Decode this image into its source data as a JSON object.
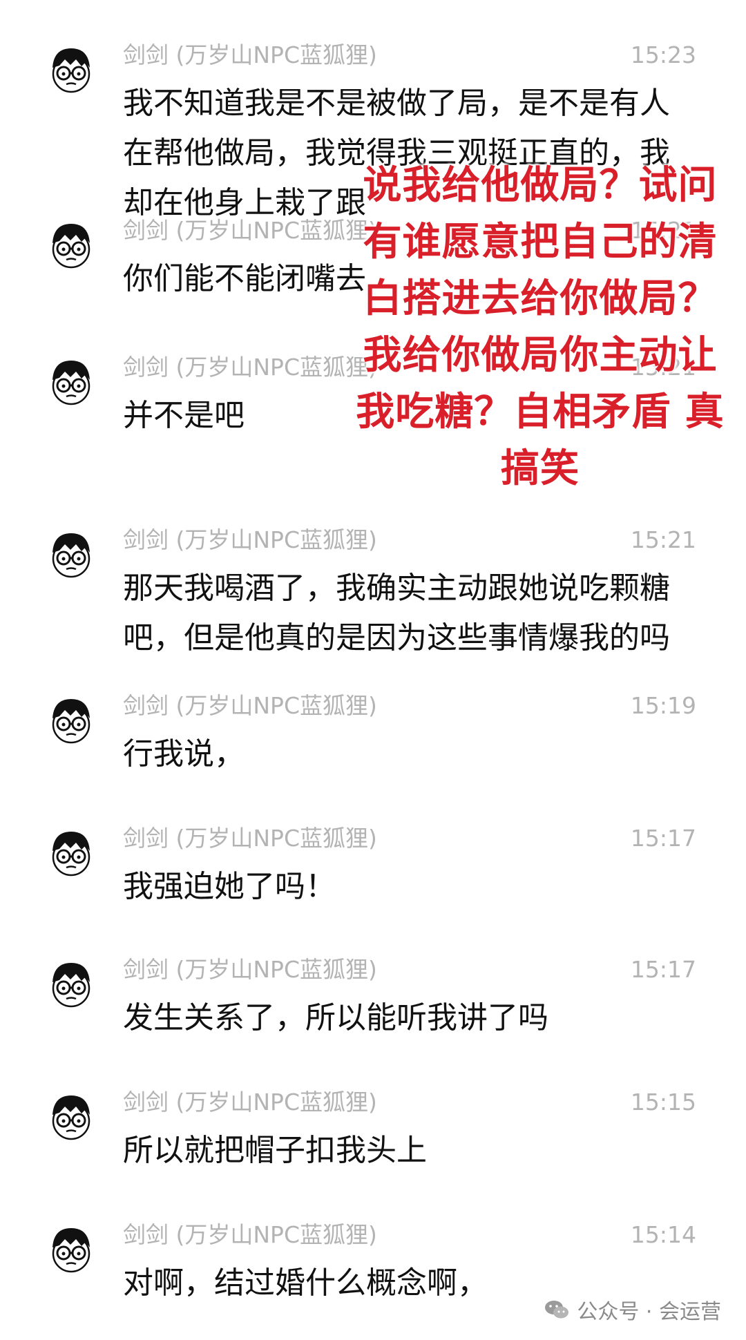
{
  "messages": [
    {
      "name": "剑剑 (万岁山NPC蓝狐狸)",
      "time": "15:23",
      "text": "我不知道我是不是被做了局，是不是有人在帮他做局，我觉得我三观挺正直的，我却在他身上栽了跟"
    },
    {
      "name": "剑剑 (万岁山NPC蓝狐狸)",
      "time": "15:21",
      "text": "你们能不能闭嘴去"
    },
    {
      "name": "剑剑 (万岁山NPC蓝狐狸)",
      "time": "15:21",
      "text": "并不是吧"
    },
    {
      "name": "剑剑 (万岁山NPC蓝狐狸)",
      "time": "15:21",
      "text": "那天我喝酒了，我确实主动跟她说吃颗糖吧，但是他真的是因为这些事情爆我的吗"
    },
    {
      "name": "剑剑 (万岁山NPC蓝狐狸)",
      "time": "15:19",
      "text": "行我说，"
    },
    {
      "name": "剑剑 (万岁山NPC蓝狐狸)",
      "time": "15:17",
      "text": "我强迫她了吗！"
    },
    {
      "name": "剑剑 (万岁山NPC蓝狐狸)",
      "time": "15:17",
      "text": "发生关系了，所以能听我讲了吗"
    },
    {
      "name": "剑剑 (万岁山NPC蓝狐狸)",
      "time": "15:15",
      "text": "所以就把帽子扣我头上"
    },
    {
      "name": "剑剑 (万岁山NPC蓝狐狸)",
      "time": "15:14",
      "text": "对啊，结过婚什么概念啊，"
    }
  ],
  "overlay_lines": [
    "说我给他做局？试问",
    "有谁愿意把自己的清",
    "白搭进去给你做局？",
    "我给你做局你主动让",
    "我吃糖？自相矛盾 真",
    "搞笑"
  ],
  "overlay_color": "#d9202a",
  "watermark": {
    "text": "公众号 · 会运营",
    "icon": "wechat-icon"
  },
  "avatar_icon": "cartoon-avatar-icon"
}
